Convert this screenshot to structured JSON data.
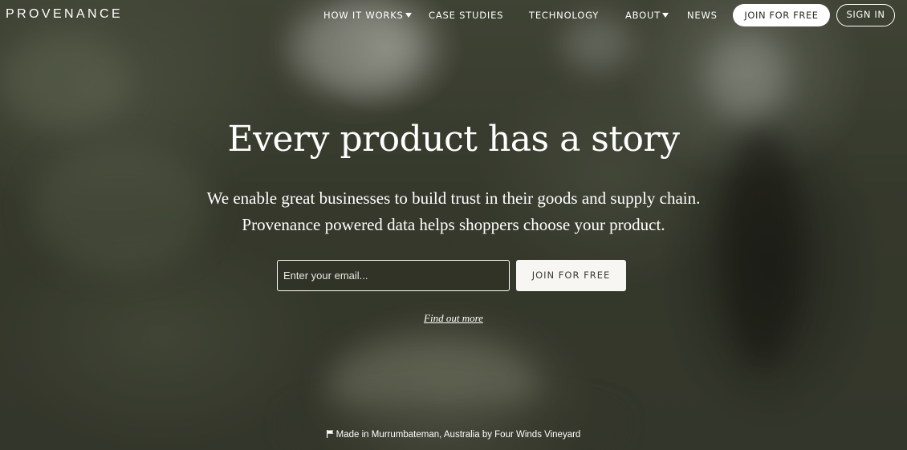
{
  "brand": {
    "logo_text": "PROVENANCE"
  },
  "nav": {
    "items": [
      {
        "label": "HOW IT WORKS",
        "has_dropdown": true,
        "icon": "chevron-down-icon"
      },
      {
        "label": "CASE STUDIES",
        "has_dropdown": false
      },
      {
        "label": "TECHNOLOGY",
        "has_dropdown": false
      },
      {
        "label": "ABOUT",
        "has_dropdown": true,
        "icon": "chevron-down-icon"
      },
      {
        "label": "NEWS",
        "has_dropdown": false
      }
    ],
    "join_label": "JOIN FOR FREE",
    "signin_label": "SIGN IN"
  },
  "hero": {
    "headline": "Every product has a story",
    "subtext_line1": "We enable great businesses to build trust in their goods and supply chain.",
    "subtext_line2": "Provenance powered data helps shoppers choose your product.",
    "email_placeholder": "Enter your email...",
    "email_value": "",
    "join_label": "JOIN FOR FREE",
    "find_out_more": "Find out more"
  },
  "caption": {
    "icon": "flag-icon",
    "text": "Made in Murrumbateman, Australia by Four Winds Vineyard"
  },
  "colors": {
    "background": "#3c4132",
    "text": "#ffffff",
    "button_fill": "#ffffff",
    "button_text": "#3a3d33"
  }
}
